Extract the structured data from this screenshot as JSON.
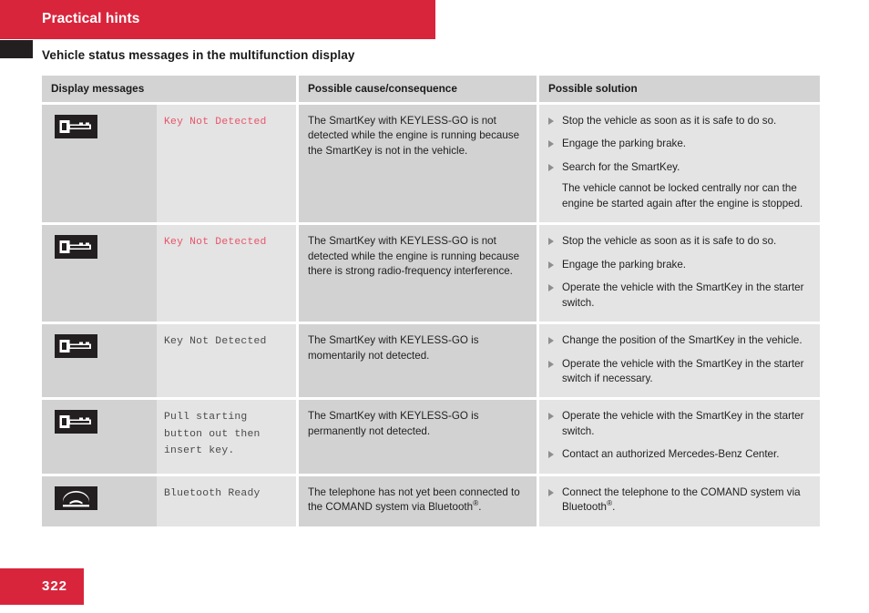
{
  "header": {
    "chapter_title": "Practical hints",
    "section_heading": "Vehicle status messages in the multifunction display"
  },
  "table": {
    "columns": {
      "display_messages": "Display messages",
      "possible_cause": "Possible cause/consequence",
      "possible_solution": "Possible solution"
    },
    "rows": [
      {
        "icon": "key-icon",
        "message": "Key Not Detected",
        "message_color": "#e8556b",
        "cause": "The SmartKey with KEYLESS-GO is not detected while the engine is running because the SmartKey is not in the vehicle.",
        "solutions": [
          {
            "text": "Stop the vehicle as soon as it is safe to do so.",
            "bullet": true
          },
          {
            "text": "Engage the parking brake.",
            "bullet": true
          },
          {
            "text": "Search for the SmartKey.",
            "bullet": true,
            "note": "The vehicle cannot be locked centrally nor can the engine be started again after the engine is stopped."
          }
        ]
      },
      {
        "icon": "key-icon",
        "message": "Key Not Detected",
        "message_color": "#e8556b",
        "cause": "The SmartKey with KEYLESS-GO is not detected while the engine is running because there is strong radio-frequency interference.",
        "solutions": [
          {
            "text": "Stop the vehicle as soon as it is safe to do so.",
            "bullet": true
          },
          {
            "text": "Engage the parking brake.",
            "bullet": true
          },
          {
            "text": "Operate the vehicle with the SmartKey in the starter switch.",
            "bullet": true
          }
        ]
      },
      {
        "icon": "key-icon",
        "message": "Key Not Detected",
        "message_color": "#4a4a4a",
        "cause": "The SmartKey with KEYLESS-GO is momentarily not detected.",
        "solutions": [
          {
            "text": "Change the position of the SmartKey in the vehicle.",
            "bullet": true
          },
          {
            "text": "Operate the vehicle with the SmartKey in the starter switch if necessary.",
            "bullet": true
          }
        ]
      },
      {
        "icon": "key-icon",
        "message": "Pull starting\nbutton out then\ninsert key.",
        "message_color": "#4a4a4a",
        "cause": "The SmartKey with KEYLESS-GO is permanently not detected.",
        "solutions": [
          {
            "text": "Operate the vehicle with the SmartKey in the starter switch.",
            "bullet": true
          },
          {
            "text": "Contact an authorized Mercedes-Benz Center.",
            "bullet": true
          }
        ]
      },
      {
        "icon": "telephone-icon",
        "message": "Bluetooth Ready",
        "message_color": "#4a4a4a",
        "cause": "The telephone has not yet been connected to the COMAND system via Bluetooth®.",
        "solutions": [
          {
            "text": "Connect the telephone to the COMAND system via Bluetooth®.",
            "bullet": true
          }
        ]
      }
    ]
  },
  "footer": {
    "page_number": "322"
  },
  "colors": {
    "brand_red": "#d8253c",
    "tab_dark": "#231f20",
    "header_cell": "#d3d3d3",
    "col_dark": "#d2d2d2",
    "col_light": "#e4e4e4",
    "message_red": "#e8556b",
    "message_gray": "#4a4a4a"
  }
}
